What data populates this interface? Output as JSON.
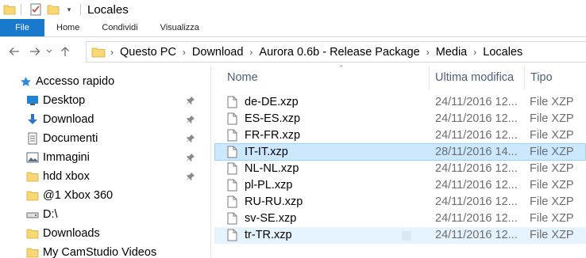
{
  "window": {
    "title": "Locales"
  },
  "ribbon": {
    "file_label": "File",
    "tabs": [
      "Home",
      "Condividi",
      "Visualizza"
    ]
  },
  "breadcrumbs": [
    "Questo PC",
    "Download",
    "Aurora 0.6b - Release Package",
    "Media",
    "Locales"
  ],
  "nav_pane": {
    "quick_access_label": "Accesso rapido",
    "items": [
      {
        "label": "Desktop",
        "icon": "desktop-icon",
        "pinned": true
      },
      {
        "label": "Download",
        "icon": "download-arrow-icon",
        "pinned": true
      },
      {
        "label": "Documenti",
        "icon": "documents-icon",
        "pinned": true
      },
      {
        "label": "Immagini",
        "icon": "pictures-icon",
        "pinned": true
      },
      {
        "label": "hdd xbox",
        "icon": "folder-icon",
        "pinned": true
      },
      {
        "label": "@1 Xbox 360",
        "icon": "folder-icon",
        "pinned": false
      },
      {
        "label": "D:\\",
        "icon": "drive-icon",
        "pinned": false
      },
      {
        "label": "Downloads",
        "icon": "folder-icon",
        "pinned": false
      },
      {
        "label": "My CamStudio Videos",
        "icon": "folder-icon",
        "pinned": false
      }
    ]
  },
  "columns": {
    "name": "Nome",
    "modified": "Ultima modifica",
    "type": "Tipo"
  },
  "files": [
    {
      "name": "de-DE.xzp",
      "modified": "24/11/2016 12...",
      "type": "File XZP"
    },
    {
      "name": "ES-ES.xzp",
      "modified": "24/11/2016 12...",
      "type": "File XZP"
    },
    {
      "name": "FR-FR.xzp",
      "modified": "24/11/2016 12...",
      "type": "File XZP"
    },
    {
      "name": "IT-IT.xzp",
      "modified": "28/11/2016 14...",
      "type": "File XZP",
      "selected": true
    },
    {
      "name": "NL-NL.xzp",
      "modified": "24/11/2016 12...",
      "type": "File XZP"
    },
    {
      "name": "pl-PL.xzp",
      "modified": "24/11/2016 12...",
      "type": "File XZP"
    },
    {
      "name": "RU-RU.xzp",
      "modified": "24/11/2016 12...",
      "type": "File XZP"
    },
    {
      "name": "sv-SE.xzp",
      "modified": "24/11/2016 12...",
      "type": "File XZP"
    },
    {
      "name": "tr-TR.xzp",
      "modified": "24/11/2016 12...",
      "type": "File XZP",
      "hovered": true
    }
  ],
  "colors": {
    "accent": "#1979ca",
    "selection_fill": "#cce8ff",
    "selection_border": "#99d1ff",
    "hover_fill": "#e5f3ff",
    "folder_yellow": "#f8d775",
    "header_text": "#4c607a"
  }
}
